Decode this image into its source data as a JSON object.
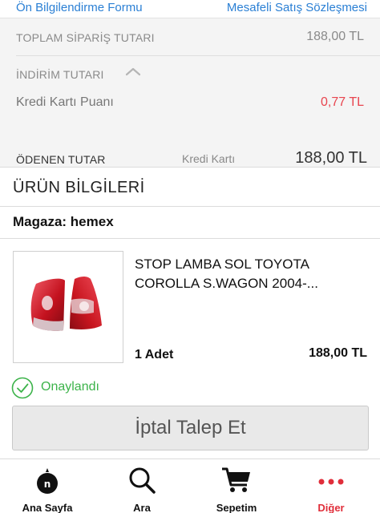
{
  "top_links": {
    "info_form": "Ön Bilgilendirme Formu",
    "distance_contract": "Mesafeli Satış Sözleşmesi"
  },
  "summary": {
    "total_label": "TOPLAM SİPARİŞ TUTARI",
    "total_value": "188,00 TL",
    "discount_label": "İNDİRİM TUTARI",
    "credit_points_label": "Kredi Kartı Puanı",
    "credit_points_value": "0,77 TL",
    "paid_label": "ÖDENEN TUTAR",
    "paid_method": "Kredi Kartı",
    "paid_value": "188,00 TL"
  },
  "product_section": {
    "header": "ÜRÜN BİLGİLERİ",
    "store": "Magaza: hemex",
    "item": {
      "title": "STOP LAMBA SOL TOYOTA COROLLA S.WAGON 2004-...",
      "quantity": "1 Adet",
      "price": "188,00 TL",
      "status": "Onaylandı"
    },
    "cancel_button": "İptal Talep Et"
  },
  "tabbar": {
    "items": [
      {
        "label": "Ana Sayfa",
        "icon": "home-logo-icon"
      },
      {
        "label": "Ara",
        "icon": "search-icon"
      },
      {
        "label": "Sepetim",
        "icon": "cart-icon"
      },
      {
        "label": "Diğer",
        "icon": "more-dots-icon"
      }
    ]
  },
  "colors": {
    "link": "#2a7fd4",
    "discount_red": "#e8454f",
    "approved_green": "#3cb34a",
    "active_tab_red": "#e02e3a"
  }
}
